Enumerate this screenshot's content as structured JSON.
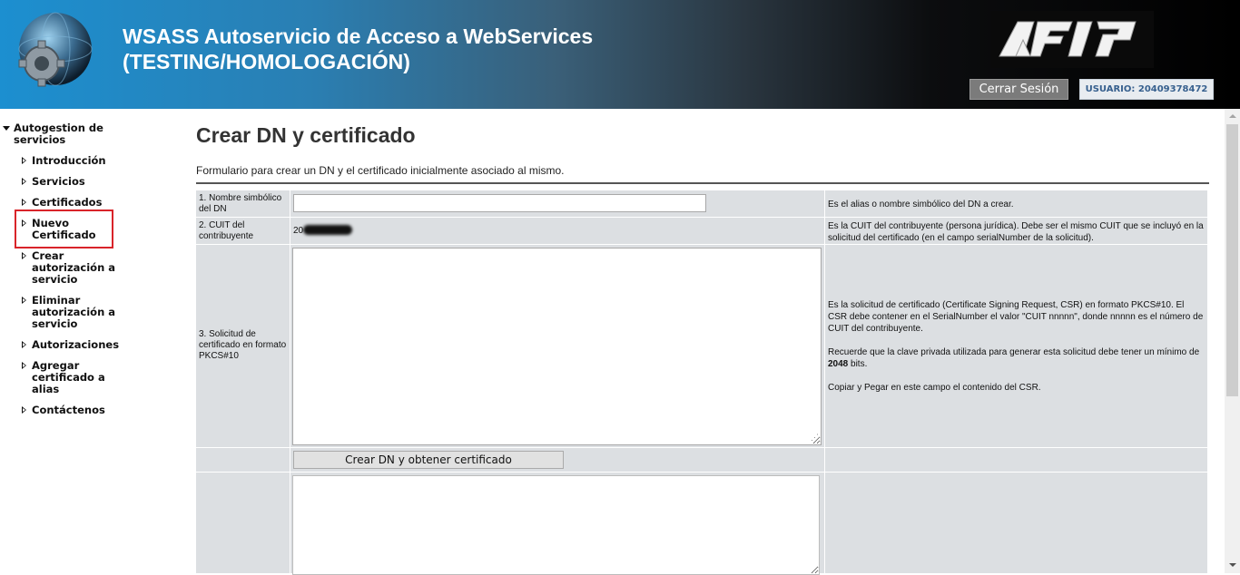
{
  "header": {
    "title_line1": "WSASS Autoservicio de Acceso a WebServices",
    "title_line2": "(TESTING/HOMOLOGACIÓN)",
    "logout_label": "Cerrar Sesión",
    "user_label": "USUARIO: 20409378472",
    "logo_icon": "afip-logo",
    "globe_icon": "globe-gear-icon"
  },
  "sidebar": {
    "root_label": "Autogestion de servicios",
    "items": [
      {
        "label": "Introducción"
      },
      {
        "label": "Servicios"
      },
      {
        "label": "Certificados"
      },
      {
        "label": "Nuevo Certificado",
        "highlighted": true
      },
      {
        "label": "Crear autorización a servicio"
      },
      {
        "label": "Eliminar autorización a servicio"
      },
      {
        "label": "Autorizaciones"
      },
      {
        "label": "Agregar certificado a alias"
      },
      {
        "label": "Contáctenos"
      }
    ],
    "highlight_color": "#d9242a"
  },
  "main": {
    "title": "Crear DN y certificado",
    "description": "Formulario para crear un DN y el certificado inicialmente asociado al mismo.",
    "fields": {
      "alias": {
        "label": "1. Nombre simbólico del DN",
        "value": "",
        "help": "Es el alias o nombre simbólico del DN a crear."
      },
      "cuit": {
        "label": "2. CUIT del contribuyente",
        "value_visible": "20",
        "help": "Es la CUIT del contribuyente (persona jurídica). Debe ser el mismo CUIT que se incluyó en la solicitud del certificado (en el campo serialNumber de la solicitud)."
      },
      "csr": {
        "label": "3. Solicitud de certificado en formato PKCS#10",
        "value": "",
        "help_p1": "Es la solicitud de certificado (Certificate Signing Request, CSR) en formato PKCS#10. El CSR debe contener en el SerialNumber el valor \"CUIT nnnnn\", donde nnnnn es el número de CUIT del contribuyente.",
        "help_p2_pre": "Recuerde que la clave privada utilizada para generar esta solicitud debe tener un mínimo de ",
        "help_p2_bold": "2048",
        "help_p2_post": " bits.",
        "help_p3": "Copiar y Pegar en este campo el contenido del CSR."
      }
    },
    "submit_label": "Crear DN y obtener certificado",
    "result_value": ""
  },
  "colors": {
    "header_start": "#1c8fd0",
    "header_end": "#000000",
    "form_cell_bg": "#dcdfe2",
    "user_badge_text": "#37608e"
  }
}
